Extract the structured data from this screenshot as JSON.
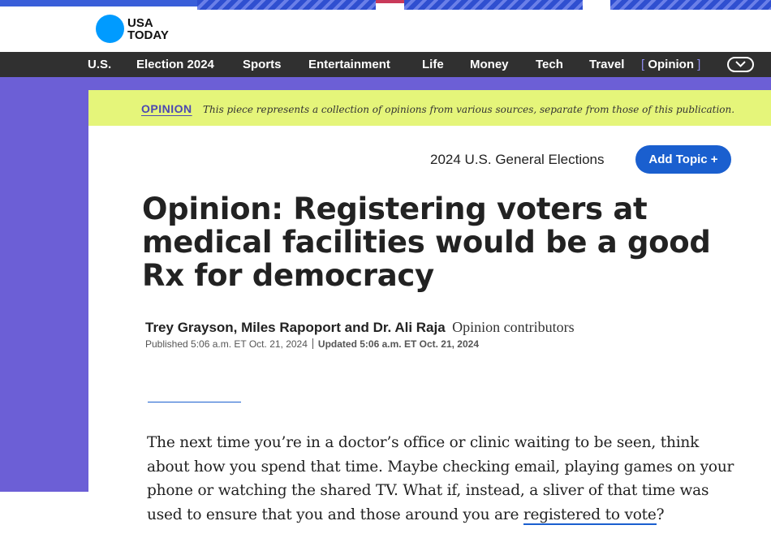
{
  "brand": {
    "logo_line1": "USA",
    "logo_line2": "TODAY",
    "logo_color": "#009bff"
  },
  "nav": {
    "items": [
      "U.S.",
      "Election 2024",
      "Sports",
      "Entertainment",
      "Life",
      "Money",
      "Tech",
      "Travel"
    ],
    "active_item": "Opinion",
    "bracket_open": "[",
    "bracket_close": "]",
    "more_icon": "chevron-down-icon"
  },
  "opinion_banner": {
    "label": "OPINION",
    "disclaimer": "This piece represents a collection of opinions from various sources, separate from those of this publication."
  },
  "topic": {
    "label": "2024 U.S. General Elections",
    "add_button": "Add Topic +"
  },
  "article": {
    "headline": "Opinion: Registering voters at medical facilities would be a good Rx for democracy",
    "authors": "Trey Grayson, Miles Rapoport and Dr. Ali Raja",
    "role": "Opinion contributors",
    "published": "Published 5:06 a.m. ET Oct. 21, 2024",
    "updated": "Updated 5:06 a.m. ET Oct. 21, 2024",
    "body_before_link": "The next time you’re in a doctor’s office or clinic waiting to be seen, think about how you spend that time. Maybe checking email, playing games on your phone or watching the shared TV. What if, instead, a sliver of that time was used to ensure that you and those around you are ",
    "body_link": "registered to vote",
    "body_after_link": "?"
  },
  "colors": {
    "nav_bg": "#303030",
    "side_panel": "#6c5fd6",
    "banner_bg": "#e5f57a",
    "accent_blue": "#1a5fcf"
  }
}
